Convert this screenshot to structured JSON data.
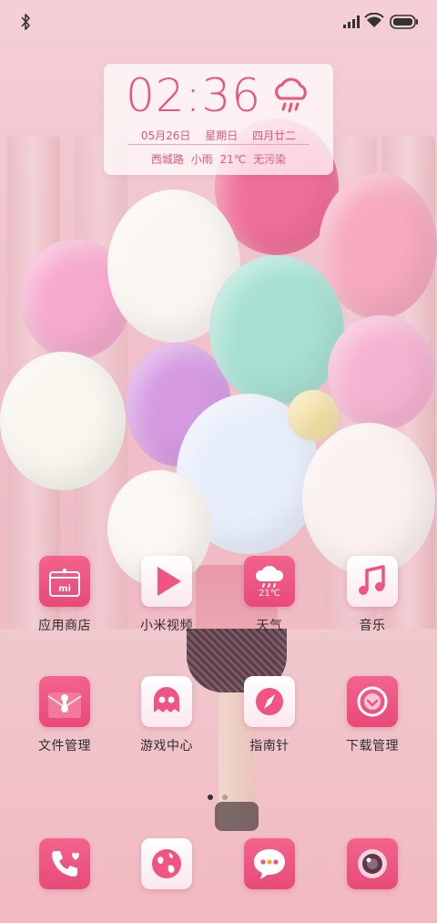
{
  "status_bar": {
    "icons": [
      "bluetooth-icon",
      "signal-icon",
      "wifi-icon",
      "battery-icon"
    ]
  },
  "clock_widget": {
    "time": "02:36",
    "date": "05月26日",
    "weekday": "星期日",
    "lunar": "四月廿二",
    "location": "西城路",
    "condition": "小雨",
    "temperature": "21℃",
    "air": "无污染",
    "weather_icon": "cloud-rain-icon"
  },
  "apps_row1": [
    {
      "label": "应用商店",
      "icon": "mi-store-icon"
    },
    {
      "label": "小米视频",
      "icon": "play-icon"
    },
    {
      "label": "天气",
      "icon": "weather-icon",
      "badge": "21℃"
    },
    {
      "label": "音乐",
      "icon": "music-note-icon"
    }
  ],
  "apps_row2": [
    {
      "label": "文件管理",
      "icon": "file-manager-icon"
    },
    {
      "label": "游戏中心",
      "icon": "ghost-icon"
    },
    {
      "label": "指南针",
      "icon": "compass-icon"
    },
    {
      "label": "下载管理",
      "icon": "download-icon"
    }
  ],
  "dock": [
    {
      "icon": "phone-icon"
    },
    {
      "icon": "browser-globe-icon"
    },
    {
      "icon": "messages-icon"
    },
    {
      "icon": "camera-icon"
    }
  ],
  "page_indicator": {
    "pages": 2,
    "current": 1
  },
  "colors": {
    "accent": "#e8567c",
    "label": "#2e2e2e"
  }
}
